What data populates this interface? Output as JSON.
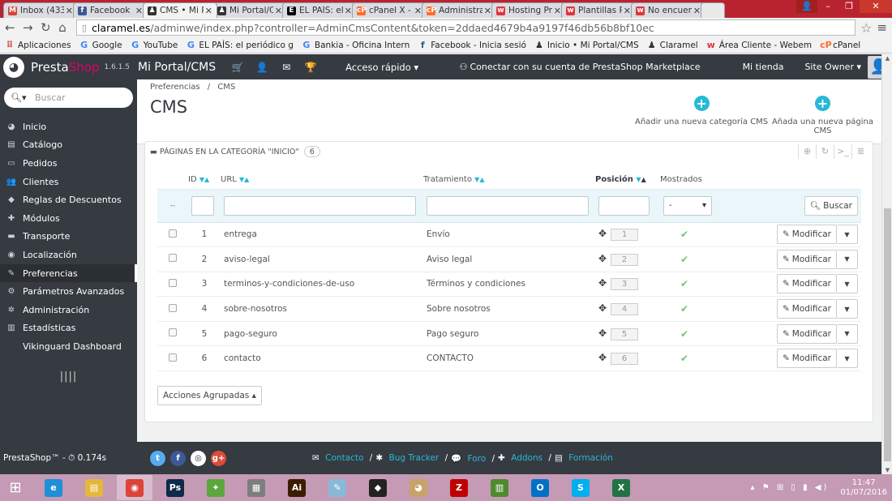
{
  "browser": {
    "tabs": [
      {
        "title": "Inbox (433)",
        "icon": "gmail-icon",
        "color": "#d44638",
        "glyph": "M",
        "active": false
      },
      {
        "title": "Facebook",
        "icon": "facebook-icon",
        "color": "#3b5998",
        "glyph": "f",
        "active": false
      },
      {
        "title": "CMS • Mi P",
        "icon": "prestashop-icon",
        "color": "#333333",
        "glyph": "♟",
        "active": true
      },
      {
        "title": "Mi Portal/C",
        "icon": "prestashop-icon",
        "color": "#333333",
        "glyph": "♟",
        "active": false
      },
      {
        "title": "EL PAÍS: el",
        "icon": "elpais-icon",
        "color": "#000000",
        "glyph": "E",
        "active": false
      },
      {
        "title": "cPanel X -",
        "icon": "cpanel-icon",
        "color": "#ff6c2c",
        "glyph": "cP",
        "active": false
      },
      {
        "title": "Administra",
        "icon": "cpanel-icon",
        "color": "#ff6c2c",
        "glyph": "cP",
        "active": false
      },
      {
        "title": "Hosting Pr",
        "icon": "webempresa-icon",
        "color": "#e0343d",
        "glyph": "w",
        "active": false
      },
      {
        "title": "Plantillas Pr",
        "icon": "webempresa-icon",
        "color": "#e0343d",
        "glyph": "w",
        "active": false
      },
      {
        "title": "No encuen",
        "icon": "webempresa-icon",
        "color": "#e0343d",
        "glyph": "w",
        "active": false
      }
    ],
    "url_domain": "claramel.es",
    "url_path": "/adminwe/index.php?controller=AdminCmsContent&token=2ddaed4679b4a9197f46db56b8bf10ec",
    "bookmarks": [
      {
        "label": "Aplicaciones",
        "icon": "apps-icon",
        "glyph": "⠿",
        "color": "#d44638"
      },
      {
        "label": "Google",
        "icon": "google-icon",
        "glyph": "G",
        "color": "#4285f4"
      },
      {
        "label": "YouTube",
        "icon": "google-icon",
        "glyph": "G",
        "color": "#4285f4"
      },
      {
        "label": "EL PAÍS: el periódico g",
        "icon": "google-icon",
        "glyph": "G",
        "color": "#4285f4"
      },
      {
        "label": "Bankia - Oficina Intern",
        "icon": "google-icon",
        "glyph": "G",
        "color": "#4285f4"
      },
      {
        "label": "Facebook - Inicia sesió",
        "icon": "facebook-icon",
        "glyph": "f",
        "color": "#3b5998"
      },
      {
        "label": "Inicio • Mi Portal/CMS",
        "icon": "prestashop-icon",
        "glyph": "♟",
        "color": "#333333"
      },
      {
        "label": "Claramel",
        "icon": "prestashop-icon",
        "glyph": "♟",
        "color": "#333333"
      },
      {
        "label": "Área Cliente - Webem",
        "icon": "webempresa-icon",
        "glyph": "w",
        "color": "#e0343d"
      },
      {
        "label": "cPanel",
        "icon": "cpanel-icon",
        "glyph": "cP",
        "color": "#ff6c2c"
      }
    ]
  },
  "header": {
    "brand_a": "Presta",
    "brand_b": "Shop",
    "version": "1.6.1.5",
    "shop_name": "Mi Portal/CMS",
    "quick_access": "Acceso rápido ▾",
    "marketplace": "Conectar con su cuenta de PrestaShop Marketplace",
    "my_shop": "Mi tienda",
    "owner": "Site Owner ▾"
  },
  "sidebar": {
    "search_placeholder": "Buscar",
    "items": [
      {
        "label": "Inicio",
        "icon": "dashboard-icon",
        "glyph": "◕",
        "active": false
      },
      {
        "label": "Catálogo",
        "icon": "book-icon",
        "glyph": "▤",
        "active": false
      },
      {
        "label": "Pedidos",
        "icon": "credit-card-icon",
        "glyph": "▭",
        "active": false
      },
      {
        "label": "Clientes",
        "icon": "users-icon",
        "glyph": "👥",
        "active": false
      },
      {
        "label": "Reglas de Descuentos",
        "icon": "tags-icon",
        "glyph": "◆",
        "active": false
      },
      {
        "label": "Módulos",
        "icon": "puzzle-icon",
        "glyph": "✚",
        "active": false
      },
      {
        "label": "Transporte",
        "icon": "truck-icon",
        "glyph": "▬",
        "active": false
      },
      {
        "label": "Localización",
        "icon": "globe-icon",
        "glyph": "◉",
        "active": false
      },
      {
        "label": "Preferencias",
        "icon": "wrench-icon",
        "glyph": "✎",
        "active": true
      },
      {
        "label": "Parámetros Avanzados",
        "icon": "cogs-icon",
        "glyph": "⚙",
        "active": false
      },
      {
        "label": "Administración",
        "icon": "cog-icon",
        "glyph": "✲",
        "active": false
      },
      {
        "label": "Estadísticas",
        "icon": "bar-chart-icon",
        "glyph": "▥",
        "active": false
      },
      {
        "label": "Vikinguard Dashboard",
        "icon": "",
        "glyph": "",
        "active": false
      }
    ]
  },
  "page": {
    "breadcrumb_a": "Preferencias",
    "breadcrumb_sep": "/",
    "breadcrumb_b": "CMS",
    "title": "CMS",
    "btn_add_category": "Añadir una nueva categoría CMS",
    "btn_add_page": "Añada una nueva página CMS"
  },
  "panel": {
    "heading": "Páginas en la categoría \"Inicio\"",
    "count": "6",
    "columns": {
      "id": "ID",
      "url": "URL",
      "treatment": "Tratamiento",
      "position": "Posición",
      "shown": "Mostrados"
    },
    "filter_dash": "--",
    "filter_select": "-",
    "search_btn": "Buscar",
    "rows": [
      {
        "id": "1",
        "url": "entrega",
        "treatment": "Envío",
        "position": "1"
      },
      {
        "id": "2",
        "url": "aviso-legal",
        "treatment": "Aviso legal",
        "position": "2"
      },
      {
        "id": "3",
        "url": "terminos-y-condiciones-de-uso",
        "treatment": "Términos y condiciones",
        "position": "3"
      },
      {
        "id": "4",
        "url": "sobre-nosotros",
        "treatment": "Sobre nosotros",
        "position": "4"
      },
      {
        "id": "5",
        "url": "pago-seguro",
        "treatment": "Pago seguro",
        "position": "5"
      },
      {
        "id": "6",
        "url": "contacto",
        "treatment": "CONTACTO",
        "position": "6"
      }
    ],
    "edit_label": "Modificar",
    "bulk_actions": "Acciones Agrupadas ▴"
  },
  "footer": {
    "version": "PrestaShop™ - ⏱ 0.174s",
    "links": [
      {
        "label": "Contacto",
        "icon": "envelope-icon",
        "glyph": "✉"
      },
      {
        "label": "Bug Tracker",
        "icon": "bug-icon",
        "glyph": "✱"
      },
      {
        "label": "Foro",
        "icon": "comments-icon",
        "glyph": "💬"
      },
      {
        "label": "Addons",
        "icon": "puzzle-icon",
        "glyph": "✚"
      },
      {
        "label": "Formación",
        "icon": "book-icon",
        "glyph": "▤"
      }
    ]
  },
  "taskbar": {
    "apps": [
      {
        "name": "internet-explorer-icon",
        "glyph": "e",
        "color": "#1e8fd8",
        "open": false
      },
      {
        "name": "file-explorer-icon",
        "glyph": "▤",
        "color": "#e5b73b",
        "open": false
      },
      {
        "name": "chrome-icon",
        "glyph": "◉",
        "color": "#db4437",
        "open": true
      },
      {
        "name": "photoshop-icon",
        "glyph": "Ps",
        "color": "#0c2a4a",
        "open": false
      },
      {
        "name": "app-icon",
        "glyph": "✦",
        "color": "#5aa83c",
        "open": false
      },
      {
        "name": "calculator-icon",
        "glyph": "▦",
        "color": "#7d7d7d",
        "open": false
      },
      {
        "name": "illustrator-icon",
        "glyph": "Ai",
        "color": "#3b1e02",
        "open": false
      },
      {
        "name": "notes-icon",
        "glyph": "✎",
        "color": "#8ab8d8",
        "open": false
      },
      {
        "name": "inkscape-icon",
        "glyph": "◆",
        "color": "#222222",
        "open": false
      },
      {
        "name": "paint-icon",
        "glyph": "◕",
        "color": "#c9a26b",
        "open": false
      },
      {
        "name": "filezilla-icon",
        "glyph": "Z",
        "color": "#bf0000",
        "open": false
      },
      {
        "name": "chart-app-icon",
        "glyph": "▥",
        "color": "#4f8a2f",
        "open": false
      },
      {
        "name": "outlook-icon",
        "glyph": "O",
        "color": "#0072c6",
        "open": false
      },
      {
        "name": "skype-icon",
        "glyph": "S",
        "color": "#00aff0",
        "open": false
      },
      {
        "name": "excel-icon",
        "glyph": "X",
        "color": "#217346",
        "open": false
      }
    ],
    "time": "11:47",
    "date": "01/07/2016"
  },
  "colors": {
    "accent": "#25b9d7",
    "dark": "#363a41",
    "magenta": "#df0067",
    "check": "#72c279"
  }
}
